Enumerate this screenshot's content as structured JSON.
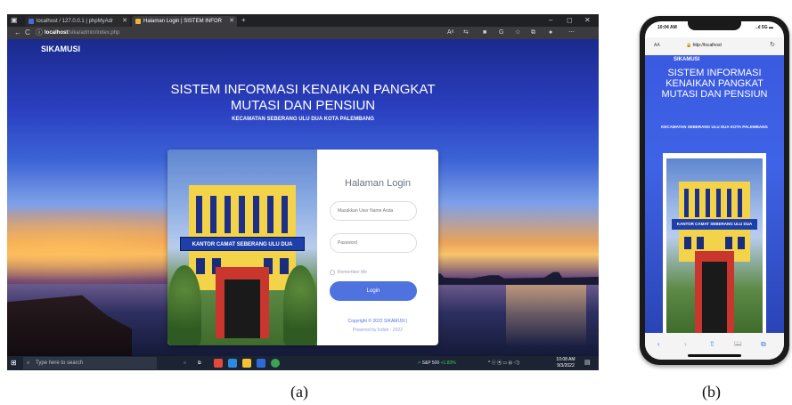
{
  "desktop": {
    "tabs": [
      {
        "label": "localhost / 127.0.0.1 | phpMyAdr"
      },
      {
        "label": "Halaman Login | SISTEM INFOR"
      }
    ],
    "new_tab": "+",
    "window_buttons": {
      "minimize": "–",
      "maximize": "◻",
      "close": "✕"
    },
    "nav": {
      "back": "←",
      "reload": "C",
      "info": "ⓘ"
    },
    "url": {
      "host": "localhost",
      "path": "/sika/admin/index.php"
    },
    "toolbar_icons": [
      "reader-icon",
      "translate-icon",
      "extension-icon",
      "favorites-icon",
      "collections-icon",
      "profile-icon",
      "more-icon"
    ],
    "page": {
      "brand": "SIKAMUSI",
      "title_line1": "SISTEM INFORMASI KENAIKAN PANGKAT",
      "title_line2": "MUTASI DAN PENSIUN",
      "subtitle": "KECAMATAN SEBERANG ULU DUA KOTA PALEMBANG",
      "building_sign": "KANTOR CAMAT SEBERANG ULU DUA",
      "login": {
        "heading": "Halaman Login",
        "username_placeholder": "Masukkan User Name Anda",
        "password_placeholder": "Password",
        "remember_label": "Remember Me",
        "button_label": "Login",
        "copyright": "Copyright © 2022 SIKAMUSI |",
        "powered": "Powered by Indah - 2022"
      }
    },
    "taskbar": {
      "search_placeholder": "Type here to search",
      "stock_label": "S&P 500",
      "stock_change": "+1.83%",
      "time": "10:08 AM",
      "date": "9/3/2022"
    }
  },
  "phone": {
    "status_time": "10:04 AM",
    "status_right": "..ıl 5G ▬",
    "aa": "AA",
    "address": "http://localhost",
    "reload": "↻",
    "page": {
      "brand": "SIKAMUSI",
      "title": "SISTEM INFORMASI KENAIKAN PANGKAT MUTASI DAN PENSIUN",
      "subtitle": "KECAMATAN SEBERANG ULU DUA KOTA PALEMBANG",
      "building_sign": "KANTOR CAMAT SEBERANG ULU DUA"
    },
    "bottom_bar": {
      "back": "‹",
      "forward": "›",
      "share": "⇧",
      "bookmarks": "📖",
      "tabs": "⧉"
    }
  },
  "captions": {
    "a": "(a)",
    "b": "(b)"
  },
  "colors": {
    "accent": "#4e73df",
    "sign_blue": "#1e3fa8",
    "building_yellow": "#f2d34a",
    "door_red": "#c8362e"
  }
}
